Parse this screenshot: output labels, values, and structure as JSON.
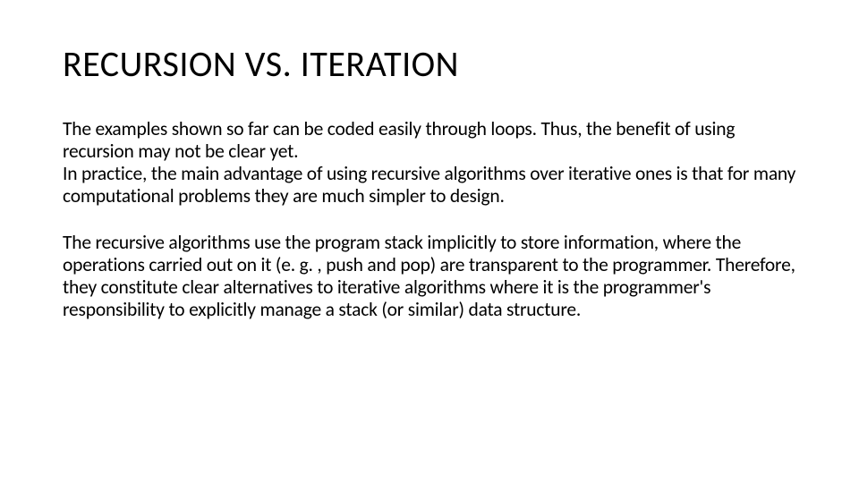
{
  "slide": {
    "title": "RECURSION VS. ITERATION",
    "para1a": "The examples shown so far can be coded easily through loops. Thus, the benefit of using recursion may not be clear yet.",
    "para1b": "In practice, the main advantage of using recursive algorithms over iterative ones is that for many computational problems they are much simpler to design.",
    "para2": "The recursive algorithms use the program stack implicitly to store information, where the operations carried out on it (e. g. , push and pop) are transparent to the programmer. Therefore, they constitute clear alternatives to iterative algorithms where it is the programmer's responsibility to explicitly manage a stack (or similar) data structure."
  }
}
